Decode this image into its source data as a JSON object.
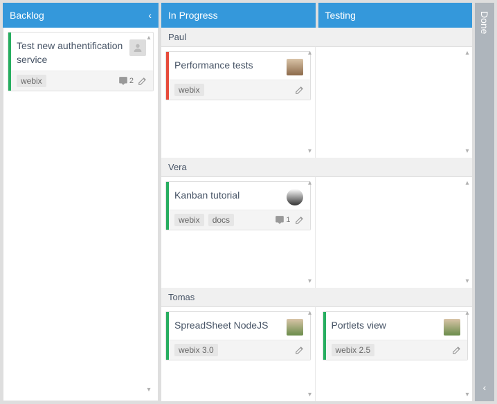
{
  "columns": {
    "backlog": {
      "title": "Backlog"
    },
    "in_progress": {
      "title": "In Progress"
    },
    "testing": {
      "title": "Testing"
    },
    "done": {
      "title": "Done"
    }
  },
  "backlog_cards": [
    {
      "text": "Test new authentification service",
      "tags": [
        "webix"
      ],
      "comments": 2,
      "stripe": "green",
      "avatar": "placeholder"
    }
  ],
  "swimlanes": [
    {
      "name": "Paul",
      "in_progress": [
        {
          "text": "Performance tests",
          "tags": [
            "webix"
          ],
          "stripe": "red",
          "avatar": "img1"
        }
      ],
      "testing": []
    },
    {
      "name": "Vera",
      "in_progress": [
        {
          "text": "Kanban tutorial",
          "tags": [
            "webix",
            "docs"
          ],
          "comments": 1,
          "stripe": "green",
          "avatar": "img2"
        }
      ],
      "testing": []
    },
    {
      "name": "Tomas",
      "in_progress": [
        {
          "text": "SpreadSheet NodeJS",
          "tags": [
            "webix 3.0"
          ],
          "stripe": "green",
          "avatar": "img3"
        }
      ],
      "testing": [
        {
          "text": "Portlets view",
          "tags": [
            "webix 2.5"
          ],
          "stripe": "green",
          "avatar": "img3"
        }
      ]
    }
  ]
}
